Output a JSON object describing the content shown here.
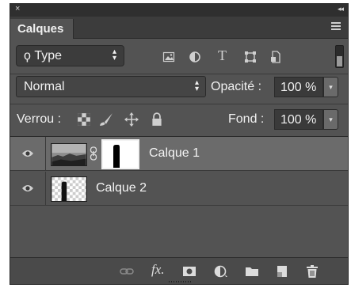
{
  "panel": {
    "close_glyph": "×",
    "collapse_glyph": "◂◂",
    "tab_label": "Calques",
    "menu_icon": "panel-menu-icon"
  },
  "filter": {
    "type_label": "ϙ Type",
    "kind_icons": [
      "image-filter-icon",
      "adjustment-filter-icon",
      "type-filter-icon",
      "shape-filter-icon",
      "smart-object-filter-icon"
    ],
    "type_filter_glyph": "T"
  },
  "blending": {
    "mode": "Normal",
    "opacity_label": "Opacité :",
    "opacity_value": "100 %",
    "fill_label": "Fond :",
    "fill_value": "100 %"
  },
  "lock": {
    "label": "Verrou :",
    "icons": [
      "lock-transparent-pixels-icon",
      "lock-image-pixels-icon",
      "lock-position-icon",
      "lock-all-icon"
    ]
  },
  "layers": [
    {
      "name": "Calque 1",
      "selected": true,
      "visible": true,
      "has_mask": true
    },
    {
      "name": "Calque 2",
      "selected": false,
      "visible": true,
      "has_mask": false
    }
  ],
  "bottom_icons": [
    "link-layers-icon",
    "layer-style-icon",
    "add-mask-icon",
    "adjustment-layer-icon",
    "new-group-icon",
    "new-layer-icon",
    "delete-layer-icon"
  ],
  "fx_label": "fx.",
  "colors": {
    "panel_bg": "#535353",
    "selected_row": "#6b6b6b",
    "text": "#f0f0f0"
  }
}
